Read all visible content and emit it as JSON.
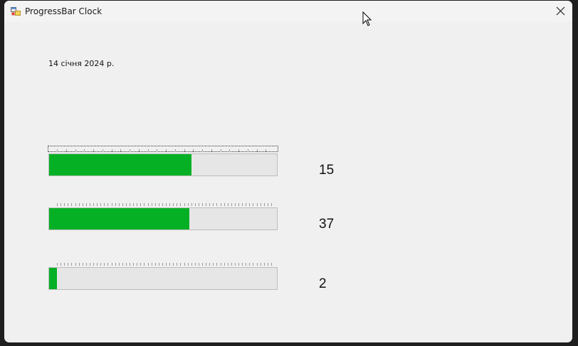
{
  "window": {
    "title": "ProgressBar Clock",
    "icon": "app-window-icon",
    "close_icon": "close-icon"
  },
  "date_label": "14 січня 2024 р.",
  "progress_bars": [
    {
      "name": "hours",
      "value": 15,
      "max": 24,
      "value_text": "15"
    },
    {
      "name": "minutes",
      "value": 37,
      "max": 60,
      "value_text": "37"
    },
    {
      "name": "seconds",
      "value": 2,
      "max": 60,
      "value_text": "2"
    }
  ],
  "colors": {
    "progress_fill": "#06b025",
    "progress_track": "#e6e6e6",
    "window_bg": "#f0f0f0"
  }
}
